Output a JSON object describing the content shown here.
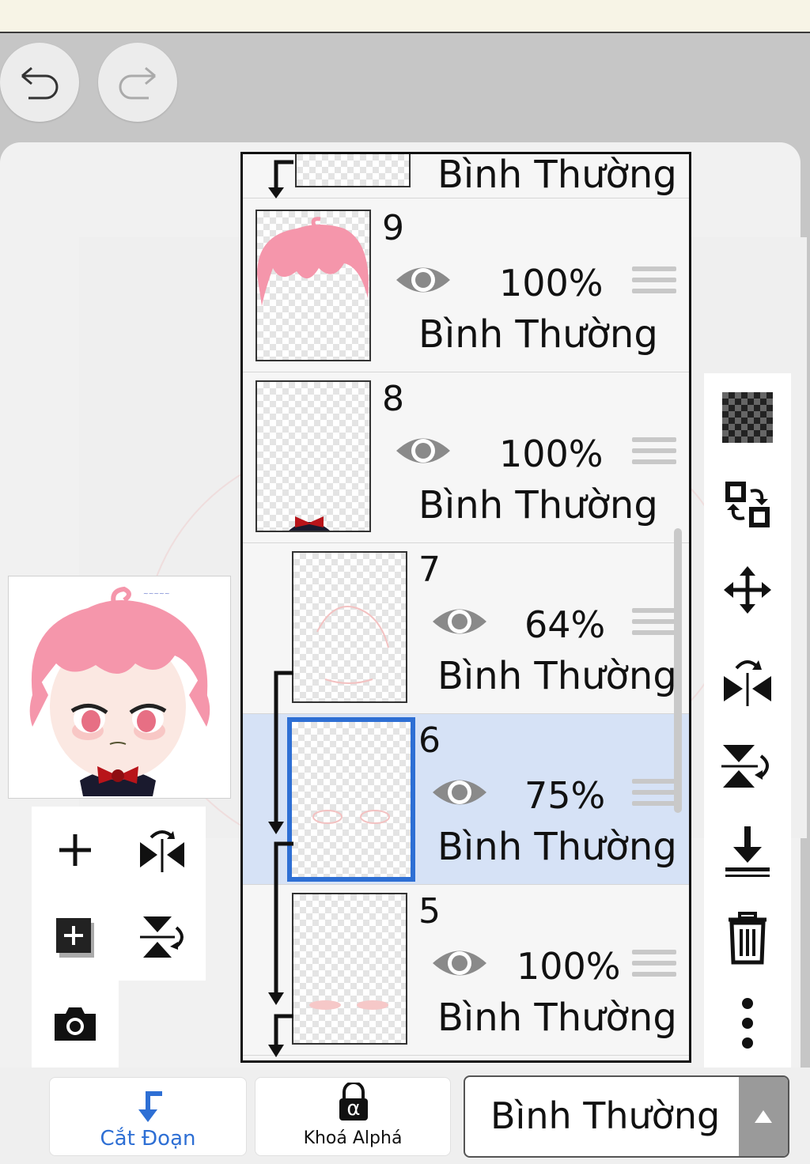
{
  "toolbar": {
    "undo_icon": "undo-icon",
    "redo_icon": "redo-icon"
  },
  "layers": [
    {
      "number": "",
      "opacity": "",
      "mode": "Bình Thường",
      "visible": true,
      "clipped": true,
      "partial": true
    },
    {
      "number": "9",
      "opacity": "100%",
      "mode": "Bình Thường",
      "visible": true,
      "clipped": false
    },
    {
      "number": "8",
      "opacity": "100%",
      "mode": "Bình Thường",
      "visible": true,
      "clipped": false
    },
    {
      "number": "7",
      "opacity": "64%",
      "mode": "Bình Thường",
      "visible": true,
      "clipped": true
    },
    {
      "number": "6",
      "opacity": "75%",
      "mode": "Bình Thường",
      "visible": true,
      "clipped": true,
      "selected": true
    },
    {
      "number": "5",
      "opacity": "100%",
      "mode": "Bình Thường",
      "visible": true,
      "clipped": true
    }
  ],
  "right_tools": [
    "checker-fill-icon",
    "swap-layers-icon",
    "move-icon",
    "flip-horizontal-icon",
    "flip-vertical-icon",
    "merge-down-icon",
    "trash-icon",
    "more-icon"
  ],
  "left_tools": [
    "add-layer-icon",
    "flip-horizontal-icon",
    "add-layer-copy-icon",
    "flip-vertical-icon",
    "camera-icon"
  ],
  "bottom": {
    "clip_label": "Cắt Đoạn",
    "alpha_label": "Khoá Alphá",
    "alpha_glyph": "α",
    "blend_mode": "Bình Thường"
  },
  "colors": {
    "accent": "#2e6fd4",
    "selected_row": "#d6e2f6",
    "hair": "#f596ab"
  }
}
